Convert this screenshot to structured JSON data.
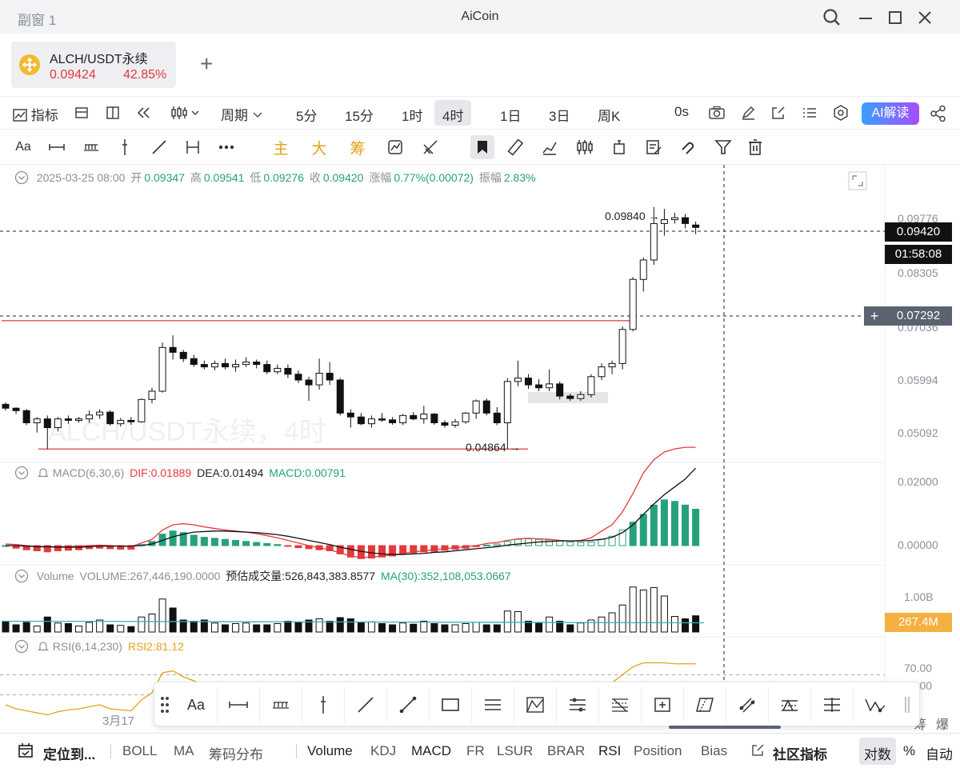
{
  "window": {
    "left_title": "副窗 1",
    "title": "AiCoin"
  },
  "symbol_tab": {
    "name": "ALCH/USDT永续",
    "price": "0.09424",
    "change_pct": "42.85%",
    "add_label": "+"
  },
  "toolbar": {
    "indicators": "指标",
    "period_menu": "周期",
    "periods": [
      "5分",
      "15分",
      "1时",
      "4时",
      "1日",
      "3日",
      "周K"
    ],
    "active_period": "4时",
    "countdown": "0s",
    "ai_button": "AI解读"
  },
  "draw_toolbar": {
    "font_label": "Aa",
    "main": "主",
    "big": "大",
    "chips": "筹"
  },
  "ohlc": {
    "date": "2025-03-25 08:00",
    "open_label": "开",
    "open": "0.09347",
    "high_label": "高",
    "high": "0.09541",
    "low_label": "低",
    "low": "0.09276",
    "close_label": "收",
    "close": "0.09420",
    "change_label": "涨幅",
    "change": "0.77%(0.00072)",
    "amp_label": "振幅",
    "amp": "2.83%"
  },
  "price_axis": {
    "ticks": [
      "0.09776",
      "0.08305",
      "0.07036",
      "0.05994",
      "0.05092"
    ],
    "current_price": "0.09420",
    "countdown": "01:58:08",
    "crosshair_price": "0.07292",
    "high_mark": "0.09840",
    "low_mark": "0.04864",
    "watermark": "ALCH/USDT永续，4时"
  },
  "macd": {
    "label": "MACD(6,30,6)",
    "dif": "DIF:0.01889",
    "dea": "DEA:0.01494",
    "macd": "MACD:0.00791",
    "ticks": [
      "0.02000",
      "0.00000"
    ]
  },
  "volume": {
    "label": "Volume",
    "value": "VOLUME:267,446,190.0000",
    "est": "预估成交量:526,843,383.8577",
    "ma": "MA(30):352,108,053.0667",
    "tick": "1.00B",
    "tag": "267.4M"
  },
  "rsi": {
    "label": "RSI(6,14,230)",
    "rsi2": "RSI2:81.12",
    "ticks": [
      "70.00",
      "50.00"
    ]
  },
  "time_axis": {
    "label": "3月17"
  },
  "right_edge": [
    "筹",
    "爆"
  ],
  "bottom_bar": {
    "locate": "定位到...",
    "items": [
      "BOLL",
      "MA",
      "筹码分布",
      "Volume",
      "KDJ",
      "MACD",
      "FR",
      "LSUR",
      "BRAR",
      "RSI",
      "Position",
      "Bias"
    ],
    "community": "社区指标",
    "log": "对数",
    "percent": "%",
    "auto": "自动"
  },
  "colors": {
    "up": "#26a17b",
    "down": "#e4393c",
    "accent": "#e3a21a"
  },
  "chart_data": {
    "type": "candlestick",
    "candles": [
      [
        0.0578,
        0.0582,
        0.0565,
        0.057
      ],
      [
        0.057,
        0.0572,
        0.0558,
        0.0565
      ],
      [
        0.0565,
        0.0568,
        0.0535,
        0.054
      ],
      [
        0.054,
        0.0552,
        0.052,
        0.0548
      ],
      [
        0.0548,
        0.0555,
        0.0486,
        0.053
      ],
      [
        0.053,
        0.0552,
        0.0522,
        0.0548
      ],
      [
        0.0548,
        0.0555,
        0.0538,
        0.0545
      ],
      [
        0.0545,
        0.0552,
        0.054,
        0.0548
      ],
      [
        0.0548,
        0.0565,
        0.054,
        0.0556
      ],
      [
        0.0556,
        0.0568,
        0.0548,
        0.0562
      ],
      [
        0.0562,
        0.0566,
        0.0534,
        0.0538
      ],
      [
        0.0538,
        0.055,
        0.0532,
        0.0545
      ],
      [
        0.0545,
        0.0552,
        0.0536,
        0.0542
      ],
      [
        0.0542,
        0.059,
        0.054,
        0.0588
      ],
      [
        0.0588,
        0.0612,
        0.058,
        0.0605
      ],
      [
        0.0605,
        0.0705,
        0.0602,
        0.0695
      ],
      [
        0.0695,
        0.072,
        0.067,
        0.0685
      ],
      [
        0.0685,
        0.069,
        0.0665,
        0.0672
      ],
      [
        0.0672,
        0.068,
        0.0655,
        0.066
      ],
      [
        0.066,
        0.0668,
        0.065,
        0.0655
      ],
      [
        0.0655,
        0.0668,
        0.0648,
        0.0662
      ],
      [
        0.0662,
        0.0672,
        0.065,
        0.0655
      ],
      [
        0.0655,
        0.067,
        0.0645,
        0.066
      ],
      [
        0.066,
        0.0675,
        0.0655,
        0.0665
      ],
      [
        0.0665,
        0.067,
        0.0652,
        0.066
      ],
      [
        0.066,
        0.0668,
        0.064,
        0.0645
      ],
      [
        0.0645,
        0.066,
        0.064,
        0.0652
      ],
      [
        0.0652,
        0.066,
        0.0632,
        0.064
      ],
      [
        0.064,
        0.0648,
        0.0622,
        0.0628
      ],
      [
        0.0628,
        0.0635,
        0.0585,
        0.0618
      ],
      [
        0.0618,
        0.0672,
        0.0608,
        0.0642
      ],
      [
        0.0642,
        0.0665,
        0.0618,
        0.0628
      ],
      [
        0.0628,
        0.0632,
        0.0555,
        0.056
      ],
      [
        0.056,
        0.0568,
        0.053,
        0.0552
      ],
      [
        0.0552,
        0.056,
        0.0535,
        0.0538
      ],
      [
        0.0538,
        0.0555,
        0.053,
        0.0548
      ],
      [
        0.0548,
        0.056,
        0.0542,
        0.0546
      ],
      [
        0.0546,
        0.0552,
        0.0536,
        0.054
      ],
      [
        0.054,
        0.0558,
        0.0535,
        0.0555
      ],
      [
        0.0555,
        0.0562,
        0.0545,
        0.0548
      ],
      [
        0.0548,
        0.0575,
        0.0538,
        0.0558
      ],
      [
        0.0558,
        0.056,
        0.0536,
        0.054
      ],
      [
        0.054,
        0.0545,
        0.053,
        0.0535
      ],
      [
        0.0535,
        0.0548,
        0.053,
        0.0542
      ],
      [
        0.0542,
        0.0562,
        0.0538,
        0.056
      ],
      [
        0.056,
        0.0588,
        0.0548,
        0.0585
      ],
      [
        0.0585,
        0.059,
        0.0555,
        0.056
      ],
      [
        0.056,
        0.0572,
        0.0535,
        0.054
      ],
      [
        0.054,
        0.0632,
        0.0486,
        0.0625
      ],
      [
        0.0625,
        0.0668,
        0.0615,
        0.0632
      ],
      [
        0.0632,
        0.064,
        0.061,
        0.0618
      ],
      [
        0.0618,
        0.063,
        0.0605,
        0.0612
      ],
      [
        0.0612,
        0.065,
        0.0605,
        0.062
      ],
      [
        0.062,
        0.0625,
        0.0588,
        0.0595
      ],
      [
        0.0595,
        0.06,
        0.0585,
        0.059
      ],
      [
        0.059,
        0.0605,
        0.0585,
        0.0598
      ],
      [
        0.0598,
        0.064,
        0.0592,
        0.0635
      ],
      [
        0.0635,
        0.0662,
        0.0628,
        0.0655
      ],
      [
        0.0655,
        0.0668,
        0.064,
        0.0662
      ],
      [
        0.0662,
        0.0738,
        0.065,
        0.0732
      ],
      [
        0.0732,
        0.084,
        0.0728,
        0.0835
      ],
      [
        0.0835,
        0.088,
        0.081,
        0.0875
      ],
      [
        0.0875,
        0.0984,
        0.0865,
        0.095
      ],
      [
        0.095,
        0.098,
        0.0925,
        0.0958
      ],
      [
        0.0958,
        0.0972,
        0.095,
        0.0962
      ],
      [
        0.0962,
        0.097,
        0.094,
        0.095
      ],
      [
        0.0947,
        0.0954,
        0.0928,
        0.0942
      ]
    ],
    "ylim": [
      0.047,
      0.1005
    ],
    "resistance": 0.075,
    "support": 0.0486,
    "high_mark": 0.0984,
    "low_mark": 0.0486,
    "macd_hist": [
      0,
      -0.0005,
      -0.0008,
      -0.001,
      -0.0012,
      -0.001,
      -0.0009,
      -0.0008,
      -0.0006,
      -0.0005,
      -0.0006,
      -0.0007,
      -0.0007,
      0.0002,
      0.0008,
      0.0022,
      0.0028,
      0.0025,
      0.002,
      0.0016,
      0.0014,
      0.0012,
      0.001,
      0.0008,
      0.0006,
      0.0004,
      0.0002,
      -0.0001,
      -0.0004,
      -0.0006,
      -0.0008,
      -0.001,
      -0.0016,
      -0.0022,
      -0.0025,
      -0.0024,
      -0.0022,
      -0.002,
      -0.0016,
      -0.0014,
      -0.0012,
      -0.0011,
      -0.0009,
      -0.0007,
      -0.0005,
      -0.0002,
      0.0001,
      0.0003,
      0.0008,
      0.0012,
      0.0013,
      0.0012,
      0.0011,
      0.0009,
      0.0007,
      0.0006,
      0.0007,
      0.0012,
      0.0018,
      0.003,
      0.0045,
      0.006,
      0.0078,
      0.0088,
      0.0085,
      0.0078,
      0.007
    ],
    "dif": [
      0.0003,
      0.0002,
      0.0,
      -0.0002,
      -0.0003,
      -0.0002,
      -0.0002,
      -0.0001,
      0.0,
      0.0001,
      0.0,
      -0.0001,
      -0.0002,
      0.0005,
      0.0012,
      0.003,
      0.004,
      0.0042,
      0.004,
      0.0036,
      0.0033,
      0.003,
      0.0028,
      0.0026,
      0.0023,
      0.0019,
      0.0015,
      0.001,
      0.0005,
      0.0,
      -0.0004,
      -0.0008,
      -0.0014,
      -0.002,
      -0.0023,
      -0.0022,
      -0.002,
      -0.0018,
      -0.0015,
      -0.0012,
      -0.001,
      -0.0008,
      -0.0006,
      -0.0004,
      -0.0002,
      0.0,
      0.0004,
      0.0006,
      0.001,
      0.0013,
      0.0014,
      0.0013,
      0.0012,
      0.001,
      0.0009,
      0.001,
      0.0015,
      0.0028,
      0.004,
      0.0065,
      0.01,
      0.014,
      0.0165,
      0.018,
      0.0186,
      0.0189,
      0.0189
    ],
    "dea": [
      0.0,
      0.0,
      -0.0001,
      -0.0002,
      -0.0002,
      -0.0003,
      -0.0003,
      -0.0003,
      -0.0002,
      -0.0001,
      -0.0001,
      -0.0001,
      -0.0001,
      0.0,
      0.0003,
      0.001,
      0.0017,
      0.0022,
      0.0026,
      0.0027,
      0.0028,
      0.0028,
      0.0027,
      0.0026,
      0.0025,
      0.0023,
      0.0021,
      0.0018,
      0.0014,
      0.001,
      0.0006,
      0.0002,
      -0.0003,
      -0.0007,
      -0.0011,
      -0.0014,
      -0.0016,
      -0.0017,
      -0.0017,
      -0.0016,
      -0.0015,
      -0.0013,
      -0.0012,
      -0.001,
      -0.0008,
      -0.0006,
      -0.0004,
      -0.0002,
      0.0001,
      0.0003,
      0.0005,
      0.0007,
      0.0008,
      0.0009,
      0.0009,
      0.0009,
      0.001,
      0.0012,
      0.0016,
      0.0025,
      0.004,
      0.006,
      0.008,
      0.0098,
      0.0113,
      0.0128,
      0.0149
    ],
    "volume": [
      0.18,
      0.12,
      0.16,
      0.1,
      0.25,
      0.15,
      0.14,
      0.1,
      0.16,
      0.2,
      0.12,
      0.11,
      0.09,
      0.25,
      0.3,
      0.55,
      0.4,
      0.2,
      0.18,
      0.2,
      0.15,
      0.12,
      0.14,
      0.15,
      0.12,
      0.12,
      0.14,
      0.18,
      0.16,
      0.2,
      0.22,
      0.18,
      0.24,
      0.22,
      0.16,
      0.17,
      0.14,
      0.12,
      0.15,
      0.13,
      0.18,
      0.14,
      0.12,
      0.12,
      0.14,
      0.16,
      0.12,
      0.12,
      0.35,
      0.34,
      0.18,
      0.16,
      0.25,
      0.18,
      0.12,
      0.15,
      0.2,
      0.25,
      0.32,
      0.45,
      0.75,
      0.7,
      0.74,
      0.6,
      0.26,
      0.22,
      0.27
    ],
    "volume_ma": 0.18,
    "rsi": [
      40,
      36,
      34,
      32,
      30,
      33,
      35,
      36,
      38,
      40,
      36,
      35,
      34,
      45,
      52,
      72,
      74,
      68,
      64,
      60,
      62,
      58,
      56,
      58,
      57,
      55,
      56,
      52,
      48,
      46,
      50,
      48,
      40,
      36,
      34,
      36,
      38,
      37,
      36,
      40,
      39,
      38,
      36,
      38,
      42,
      48,
      44,
      40,
      55,
      58,
      55,
      52,
      54,
      50,
      48,
      50,
      56,
      60,
      62,
      70,
      78,
      82,
      82,
      82,
      81,
      81,
      81
    ]
  }
}
